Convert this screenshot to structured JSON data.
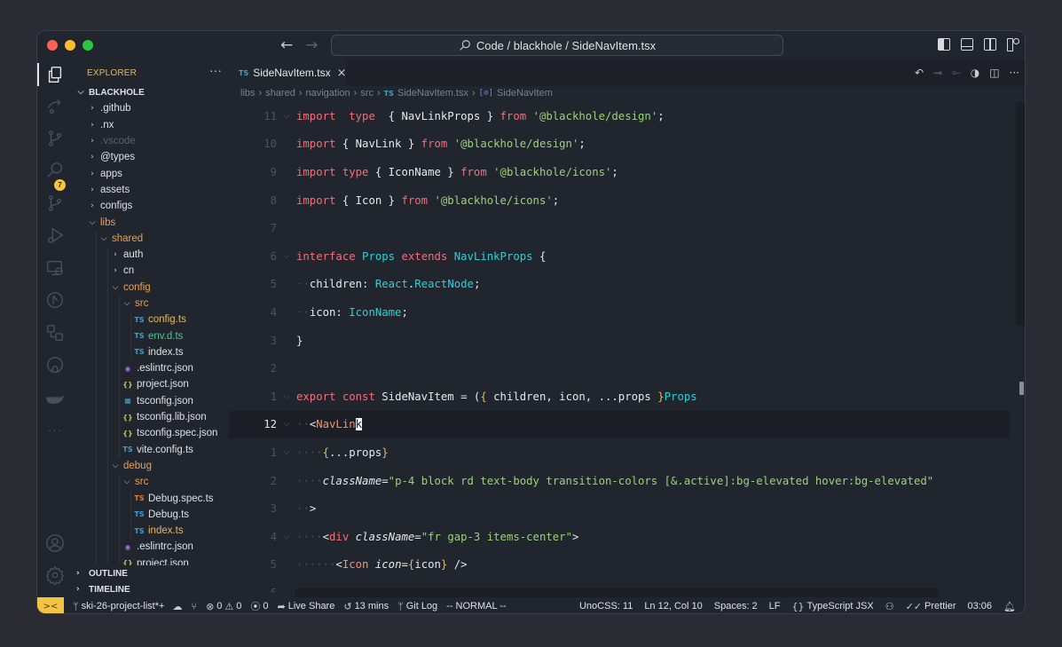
{
  "titlebar": {
    "command_center": "Code / blackhole / SideNavItem.tsx",
    "back_icon": "arrow-left-icon",
    "forward_icon": "arrow-right-icon",
    "layout_icons": [
      "toggle-primary-sidebar-icon",
      "toggle-panel-icon",
      "toggle-secondary-sidebar-icon",
      "customize-layout-icon"
    ]
  },
  "activity_bar": {
    "items": [
      "explorer-icon",
      "live-share-icon",
      "source-control-icon",
      "search-icon",
      "git-graph-icon",
      "run-debug-icon",
      "remote-explorer-icon",
      "pull-requests-icon",
      "nx-icon",
      "github-icon",
      "docker-icon",
      "more-icon"
    ],
    "badge": "7",
    "bottom": [
      "accounts-icon",
      "settings-icon"
    ]
  },
  "sidebar": {
    "title": "EXPLORER",
    "more": "···",
    "root": "BLACKHOLE",
    "tree": [
      {
        "label": ".github",
        "depth": 1,
        "type": "folder",
        "open": false,
        "color": ""
      },
      {
        "label": ".nx",
        "depth": 1,
        "type": "folder",
        "open": false,
        "color": ""
      },
      {
        "label": ".vscode",
        "depth": 1,
        "type": "folder",
        "open": false,
        "color": "dim"
      },
      {
        "label": "@types",
        "depth": 1,
        "type": "folder",
        "open": false,
        "color": ""
      },
      {
        "label": "apps",
        "depth": 1,
        "type": "folder",
        "open": false,
        "color": ""
      },
      {
        "label": "assets",
        "depth": 1,
        "type": "folder",
        "open": false,
        "color": ""
      },
      {
        "label": "configs",
        "depth": 1,
        "type": "folder",
        "open": false,
        "color": ""
      },
      {
        "label": "libs",
        "depth": 1,
        "type": "folder",
        "open": true,
        "color": "folder-open"
      },
      {
        "label": "shared",
        "depth": 2,
        "type": "folder",
        "open": true,
        "color": "folder-open"
      },
      {
        "label": "auth",
        "depth": 3,
        "type": "folder",
        "open": false,
        "color": ""
      },
      {
        "label": "cn",
        "depth": 3,
        "type": "folder",
        "open": false,
        "color": ""
      },
      {
        "label": "config",
        "depth": 3,
        "type": "folder",
        "open": true,
        "color": "folder-open"
      },
      {
        "label": "src",
        "depth": 4,
        "type": "folder",
        "open": true,
        "color": "folder-open"
      },
      {
        "label": "config.ts",
        "depth": 5,
        "type": "ts",
        "color": "ts-mod"
      },
      {
        "label": "env.d.ts",
        "depth": 5,
        "type": "ts",
        "color": "ts-new"
      },
      {
        "label": "index.ts",
        "depth": 5,
        "type": "ts",
        "color": ""
      },
      {
        "label": ".eslintrc.json",
        "depth": 4,
        "type": "eslint",
        "color": ""
      },
      {
        "label": "project.json",
        "depth": 4,
        "type": "json",
        "color": ""
      },
      {
        "label": "tsconfig.json",
        "depth": 4,
        "type": "tsconfig",
        "color": ""
      },
      {
        "label": "tsconfig.lib.json",
        "depth": 4,
        "type": "json",
        "color": ""
      },
      {
        "label": "tsconfig.spec.json",
        "depth": 4,
        "type": "json",
        "color": ""
      },
      {
        "label": "vite.config.ts",
        "depth": 4,
        "type": "ts",
        "color": ""
      },
      {
        "label": "debug",
        "depth": 3,
        "type": "folder",
        "open": true,
        "color": "folder-open"
      },
      {
        "label": "src",
        "depth": 4,
        "type": "folder",
        "open": true,
        "color": "folder-open"
      },
      {
        "label": "Debug.spec.ts",
        "depth": 5,
        "type": "ts-spec",
        "color": ""
      },
      {
        "label": "Debug.ts",
        "depth": 5,
        "type": "ts",
        "color": ""
      },
      {
        "label": "index.ts",
        "depth": 5,
        "type": "ts",
        "color": "ts-mod"
      },
      {
        "label": ".eslintrc.json",
        "depth": 4,
        "type": "eslint",
        "color": ""
      },
      {
        "label": "project.json",
        "depth": 4,
        "type": "json",
        "color": ""
      }
    ],
    "outline": "OUTLINE",
    "timeline": "TIMELINE"
  },
  "editor": {
    "tab": {
      "icon": "TS",
      "label": "SideNavItem.tsx",
      "close": "×"
    },
    "tab_actions": [
      "go-back-icon",
      "previous-change-icon",
      "next-change-icon",
      "git-blame-icon",
      "split-editor-icon",
      "more-actions-icon"
    ],
    "breadcrumbs": [
      "libs",
      "shared",
      "navigation",
      "src",
      "SideNavItem.tsx",
      "SideNavItem"
    ],
    "lines": [
      {
        "num": "11",
        "fold": true,
        "tokens": [
          [
            "k",
            "import"
          ],
          [
            "",
            "  "
          ],
          [
            "k",
            "type"
          ],
          [
            "",
            "  { NavLinkProps } "
          ],
          [
            "k",
            "from"
          ],
          [
            "",
            " "
          ],
          [
            "s",
            "'@blackhole/design'"
          ],
          [
            "",
            ";"
          ]
        ]
      },
      {
        "num": "10",
        "fold": false,
        "tokens": [
          [
            "k",
            "import"
          ],
          [
            "",
            " { NavLink } "
          ],
          [
            "k",
            "from"
          ],
          [
            "",
            " "
          ],
          [
            "s",
            "'@blackhole/design'"
          ],
          [
            "",
            ";"
          ]
        ]
      },
      {
        "num": "9",
        "fold": false,
        "tokens": [
          [
            "k",
            "import"
          ],
          [
            "",
            " "
          ],
          [
            "k",
            "type"
          ],
          [
            "",
            " { IconName } "
          ],
          [
            "k",
            "from"
          ],
          [
            "",
            " "
          ],
          [
            "s",
            "'@blackhole/icons'"
          ],
          [
            "",
            ";"
          ]
        ]
      },
      {
        "num": "8",
        "fold": false,
        "tokens": [
          [
            "k",
            "import"
          ],
          [
            "",
            " { Icon } "
          ],
          [
            "k",
            "from"
          ],
          [
            "",
            " "
          ],
          [
            "s",
            "'@blackhole/icons'"
          ],
          [
            "",
            ";"
          ]
        ]
      },
      {
        "num": "7",
        "fold": false,
        "tokens": []
      },
      {
        "num": "6",
        "fold": true,
        "tokens": [
          [
            "k",
            "interface"
          ],
          [
            "",
            " "
          ],
          [
            "t",
            "Props"
          ],
          [
            "",
            " "
          ],
          [
            "k",
            "extends"
          ],
          [
            "",
            " "
          ],
          [
            "t",
            "NavLinkProps"
          ],
          [
            "",
            " {"
          ]
        ]
      },
      {
        "num": "5",
        "fold": false,
        "tokens": [
          [
            "ws",
            "··"
          ],
          [
            "",
            "children: "
          ],
          [
            "t",
            "React"
          ],
          [
            "",
            "."
          ],
          [
            "t",
            "ReactNode"
          ],
          [
            "",
            ";"
          ]
        ]
      },
      {
        "num": "4",
        "fold": false,
        "tokens": [
          [
            "ws",
            "··"
          ],
          [
            "",
            "icon: "
          ],
          [
            "t",
            "IconName"
          ],
          [
            "",
            ";"
          ]
        ]
      },
      {
        "num": "3",
        "fold": false,
        "tokens": [
          [
            "",
            "}"
          ]
        ]
      },
      {
        "num": "2",
        "fold": false,
        "tokens": []
      },
      {
        "num": "1",
        "fold": true,
        "tokens": [
          [
            "k",
            "export"
          ],
          [
            "",
            " "
          ],
          [
            "k",
            "const"
          ],
          [
            "",
            " SideNavItem = ("
          ],
          [
            "b",
            "{"
          ],
          [
            "",
            " children, icon, ...props "
          ],
          [
            "b",
            "}"
          ],
          [
            ": "
          ],
          [
            "t",
            "Props"
          ],
          [
            ") ⇒ ("
          ]
        ]
      },
      {
        "num": "12",
        "fold": true,
        "current": true,
        "tokens": [
          [
            "ws",
            "··"
          ],
          [
            "",
            "<"
          ],
          [
            "comp",
            "NavLin"
          ],
          [
            "cursor",
            "k"
          ]
        ]
      },
      {
        "num": "1",
        "fold": true,
        "tokens": [
          [
            "ws",
            "····"
          ],
          [
            "b",
            "{"
          ],
          [
            "",
            "...props"
          ],
          [
            "b",
            "}"
          ]
        ]
      },
      {
        "num": "2",
        "fold": false,
        "tokens": [
          [
            "ws",
            "····"
          ],
          [
            "attr",
            "className"
          ],
          [
            "",
            "="
          ],
          [
            "s",
            "\"p-4 block rd text-body transition-colors [&.active]:bg-elevated hover:bg-elevated\""
          ]
        ]
      },
      {
        "num": "3",
        "fold": false,
        "tokens": [
          [
            "ws",
            "··"
          ],
          [
            "",
            ">"
          ]
        ]
      },
      {
        "num": "4",
        "fold": true,
        "tokens": [
          [
            "ws",
            "····"
          ],
          [
            "",
            "<"
          ],
          [
            "tag",
            "div"
          ],
          [
            "",
            " "
          ],
          [
            "attr",
            "className"
          ],
          [
            "",
            "="
          ],
          [
            "s",
            "\"fr gap-3 items-center\""
          ],
          [
            "",
            ">"
          ]
        ]
      },
      {
        "num": "5",
        "fold": false,
        "tokens": [
          [
            "ws",
            "······"
          ],
          [
            "",
            "<"
          ],
          [
            "comp",
            "Icon"
          ],
          [
            "",
            " "
          ],
          [
            "attr",
            "icon"
          ],
          [
            "",
            "="
          ],
          [
            "b",
            "{"
          ],
          [
            "",
            "icon"
          ],
          [
            "b",
            "}"
          ],
          [
            "",
            " />"
          ]
        ]
      },
      {
        "num": "6",
        "fold": false,
        "tokens": []
      }
    ]
  },
  "statusbar": {
    "remote": "><",
    "branch": "ski-26-project-list*+",
    "errors": "0",
    "warnings": "0",
    "ports": "0",
    "live_share": "Live Share",
    "time_tracked": "13 mins",
    "git_log": "Git Log",
    "vim_mode": "-- NORMAL --",
    "unocss": "UnoCSS: 11",
    "cursor_pos": "Ln 12, Col 10",
    "indent": "Spaces: 2",
    "eol": "LF",
    "language": "TypeScript JSX",
    "formatter": "Prettier",
    "clock": "03:06"
  },
  "colors": {
    "accent_yellow": "#f5c542",
    "keyword": "#f0707a",
    "type": "#2ccfd8",
    "string": "#9ad27a",
    "bracket": "#e4b864",
    "component": "#f5916a",
    "folder_open": "#e4a25a"
  }
}
